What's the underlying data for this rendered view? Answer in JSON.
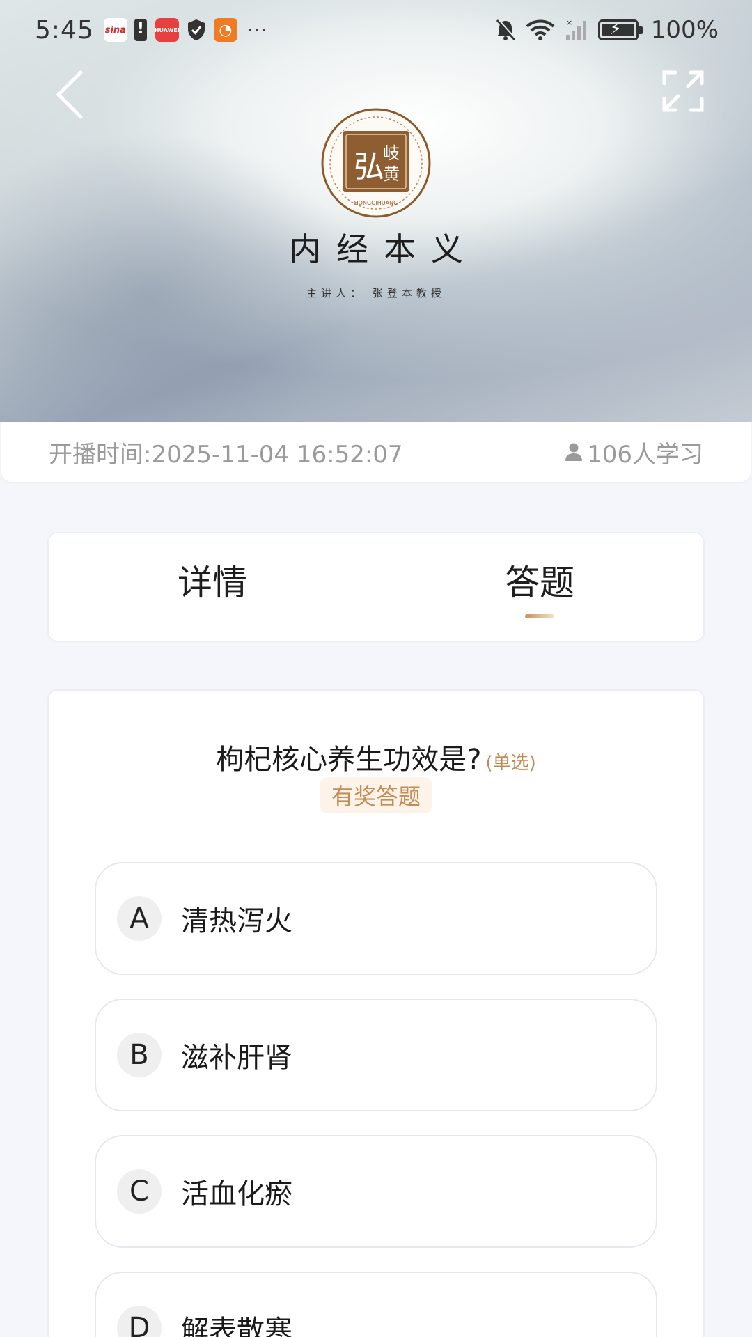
{
  "status_bar": {
    "time": "5:45",
    "app_icons": [
      "sina-icon",
      "battery-alert-icon",
      "huawei-icon",
      "shield-icon",
      "orange-app-icon"
    ],
    "more": "···",
    "battery_percent": "100%"
  },
  "video": {
    "logo_text": "弘岐黄",
    "course_title": "内经本义",
    "lecturer": "主讲人：  张登本教授"
  },
  "info": {
    "start_time": "开播时间:2025-11-04 16:52:07",
    "learners": "106人学习"
  },
  "tabs": [
    {
      "label": "详情",
      "active": false
    },
    {
      "label": "答题",
      "active": true
    }
  ],
  "question": {
    "text": "枸杞核心养生功效是?",
    "type": "(单选)",
    "reward_tag": "有奖答题",
    "options": [
      {
        "letter": "A",
        "text": "清热泻火"
      },
      {
        "letter": "B",
        "text": "滋补肝肾"
      },
      {
        "letter": "C",
        "text": "活血化瘀"
      },
      {
        "letter": "D",
        "text": "解表散寒"
      }
    ]
  },
  "colors": {
    "accent": "#c48c55",
    "reward_bg": "#fdf3e9",
    "page_bg": "#f4f6fb"
  }
}
